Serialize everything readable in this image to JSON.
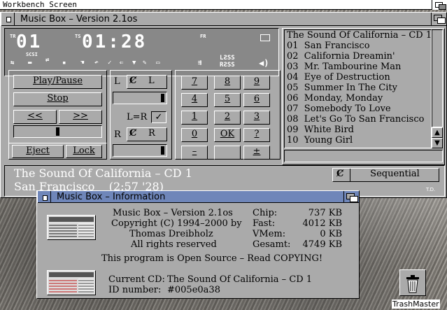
{
  "screen": {
    "title": "Workbench Screen"
  },
  "main_window": {
    "title": "Music Box – Version 2.1os",
    "lcd": {
      "track_label": "TR",
      "track": "01",
      "time_label": "TS",
      "time": "01:28",
      "fr_label": "FR",
      "scsi_label": "SCSI",
      "lsss_top": "LƧSS",
      "lsss_bottom": "RƧSS"
    },
    "buttons": {
      "play_pause": "Play/Pause",
      "stop": "Stop",
      "rewind": "<<",
      "forward": ">>",
      "eject": "Eject",
      "lock": "Lock"
    },
    "volume": {
      "left_label": "L",
      "left_cycle": "L",
      "lr_label": "L=R",
      "right_label": "R",
      "right_cycle": "R"
    },
    "keypad": [
      "7",
      "8",
      "9",
      "4",
      "5",
      "6",
      "1",
      "2",
      "3",
      "0",
      "OK",
      "?",
      "–",
      "",
      "±"
    ],
    "playlist": {
      "header": "The Sound Of California – CD 1:",
      "tracks": [
        "01  San Francisco",
        "02  California Dreamin'",
        "03  Mr. Tambourine Man",
        "04  Eye of Destruction",
        "05  Summer In The City",
        "06  Monday, Monday",
        "07  Somebody To Love",
        "08  Let's Go To San Francisco",
        "09  White Bird",
        "10  Young Girl"
      ]
    },
    "status": {
      "cd_title": "The Sound Of California – CD 1",
      "track_line": "San Francisco    (2:57 '28)",
      "mode": "Sequential",
      "signature": "T.D."
    }
  },
  "info_window": {
    "title": "Music Box – Information",
    "program": "Music Box – Version 2.1os",
    "copyright": "Copyright (C) 1994–2000 by",
    "author": "Thomas Dreibholz",
    "rights": "All rights reserved",
    "memory": [
      {
        "label": "Chip:",
        "value": "737 KB"
      },
      {
        "label": "Fast:",
        "value": "4012 KB"
      },
      {
        "label": "VMem:",
        "value": "0 KB"
      },
      {
        "label": "Gesamt:",
        "value": "4749 KB"
      }
    ],
    "open_source": "This program is Open Source – Read COPYING!",
    "current_cd_label": "Current CD:",
    "current_cd_value": "The Sound Of California – CD 1",
    "id_label": "ID number:",
    "id_value": "#005e0a38"
  },
  "desktop": {
    "trash_label": "TrashMaster"
  }
}
